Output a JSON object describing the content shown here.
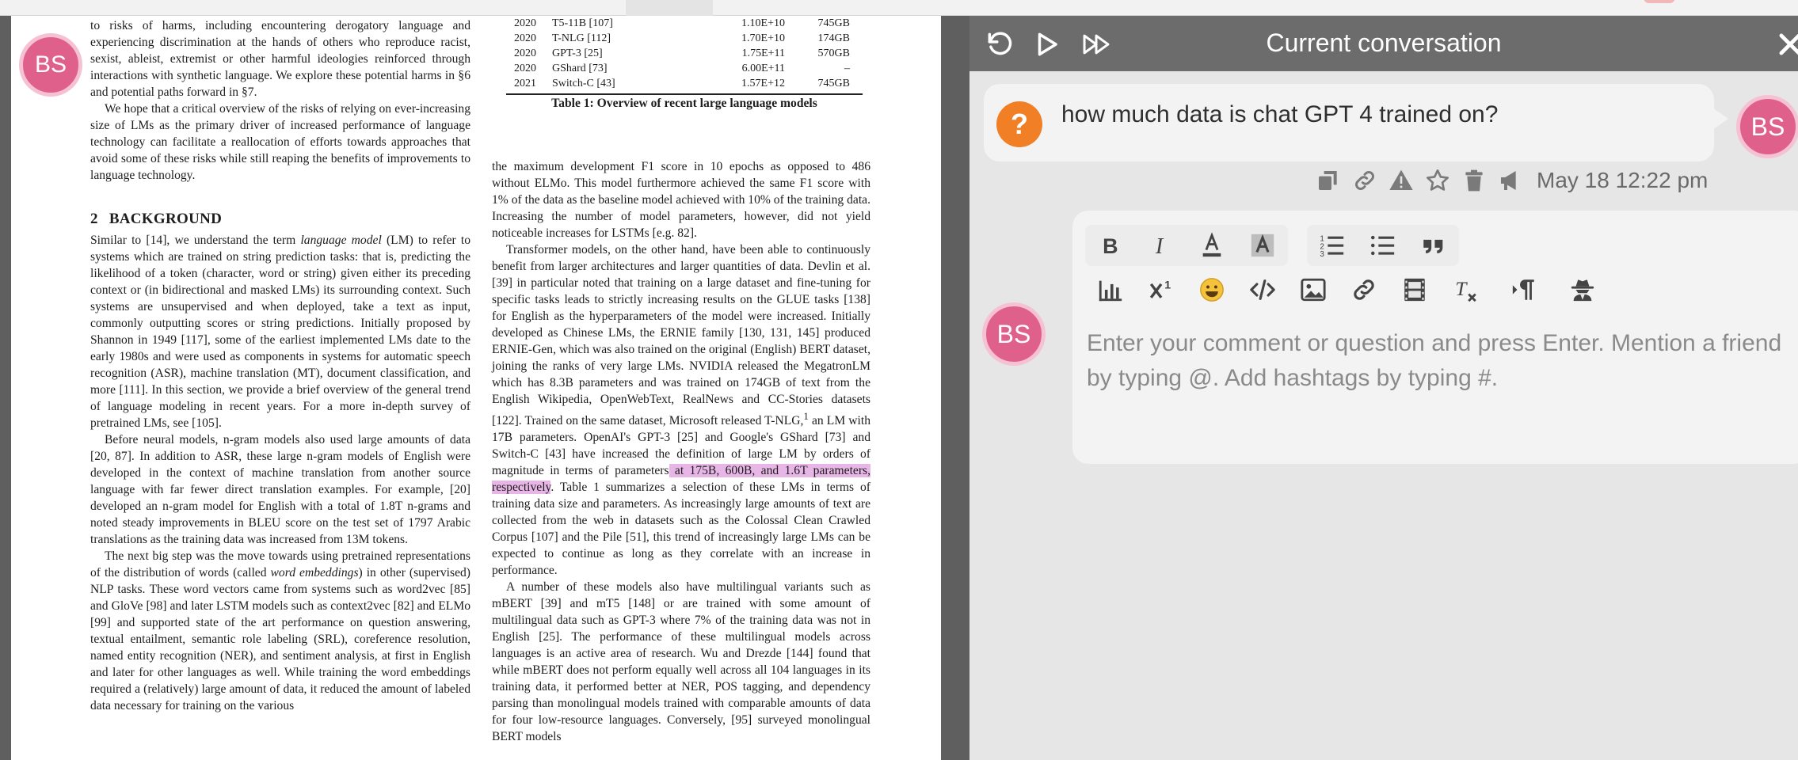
{
  "doc": {
    "avatar_initials": "BS",
    "col1": {
      "p1": "to risks of harms, including encountering derogatory language and experiencing discrimination at the hands of others who reproduce racist, sexist, ableist, extremist or other harmful ideologies reinforced through interactions with synthetic language. We explore these potential harms in §6 and potential paths forward in §7.",
      "p2": "We hope that a critical overview of the risks of relying on ever-increasing size of LMs as the primary driver of increased performance of language technology can facilitate a reallocation of efforts towards approaches that avoid some of these risks while still reaping the benefits of improvements to language technology.",
      "section_number": "2",
      "section_title": "BACKGROUND",
      "p3_a": "Similar to [14], we understand the term ",
      "p3_em": "language model",
      "p3_b": " (LM) to refer to systems which are trained on string prediction tasks: that is, predicting the likelihood of a token (character, word or string) given either its preceding context or (in bidirectional and masked LMs) its surrounding context. Such systems are unsupervised and when deployed, take a text as input, commonly outputting scores or string predictions. Initially proposed by Shannon in 1949 [117], some of the earliest implemented LMs date to the early 1980s and were used as components in systems for automatic speech recognition (ASR), machine translation (MT), document classification, and more [111]. In this section, we provide a brief overview of the general trend of language modeling in recent years. For a more in-depth survey of pretrained LMs, see [105].",
      "p4": "Before neural models, n-gram models also used large amounts of data [20, 87]. In addition to ASR, these large n-gram models of English were developed in the context of machine translation from another source language with far fewer direct translation examples. For example, [20] developed an n-gram model for English with a total of 1.8T n-grams and noted steady improvements in BLEU score on the test set of 1797 Arabic translations as the training data was increased from 13M tokens.",
      "p5_a": "The next big step was the move towards using pretrained representations of the distribution of words (called ",
      "p5_em": "word embeddings",
      "p5_b": ") in other (supervised) NLP tasks. These word vectors came from systems such as word2vec [85] and GloVe [98] and later LSTM models such as context2vec [82] and ELMo [99] and supported state of the art performance on question answering, textual entailment, semantic role labeling (SRL), coreference resolution, named entity recognition (NER), and sentiment analysis, at first in English and later for other languages as well. While training the word embeddings required a (relatively) large amount of data, it reduced the amount of labeled data necessary for training on the various"
    },
    "table": {
      "rows": [
        {
          "year": "2020",
          "model": "T5-11B [107]",
          "params": "1.10E+10",
          "size": "745GB"
        },
        {
          "year": "2020",
          "model": "T-NLG [112]",
          "params": "1.70E+10",
          "size": "174GB"
        },
        {
          "year": "2020",
          "model": "GPT-3 [25]",
          "params": "1.75E+11",
          "size": "570GB"
        },
        {
          "year": "2020",
          "model": "GShard [73]",
          "params": "6.00E+11",
          "size": "–"
        },
        {
          "year": "2021",
          "model": "Switch-C [43]",
          "params": "1.57E+12",
          "size": "745GB"
        }
      ],
      "caption": "Table 1: Overview of recent large language models"
    },
    "col2": {
      "p1": "the maximum development F1 score in 10 epochs as opposed to 486 without ELMo. This model furthermore achieved the same F1 score with 1% of the data as the baseline model achieved with 10% of the training data. Increasing the number of model parameters, however, did not yield noticeable increases for LSTMs [e.g. 82].",
      "p2_a": "Transformer models, on the other hand, have been able to continuously benefit from larger architectures and larger quantities of data. Devlin et al. [39] in particular noted that training on a large dataset and fine-tuning for specific tasks leads to strictly increasing results on the GLUE tasks [138] for English as the hyperparameters of the model were increased. Initially developed as Chinese LMs, the ERNIE family [130, 131, 145] produced ERNIE-Gen, which was also trained on the original (English) BERT dataset, joining the ranks of very large LMs. NVIDIA released the MegatronLM which has 8.3B parameters and was trained on 174GB of text from the English Wikipedia, OpenWebText, RealNews and CC-Stories datasets [122]. Trained on the same dataset, Microsoft released T-NLG,",
      "p2_sup": "1",
      "p2_b": " an LM with 17B parameters. OpenAI's GPT-3 [25] and Google's GShard [73] and Switch-C [43] have increased the definition of large LM by orders of magnitude in terms of parameters",
      "p2_hl": " at 175B, 600B, and 1.6T parameters, respectively",
      "p2_c": ". Table 1 summarizes a selection of these LMs in terms of training data size and parameters. As increasingly large amounts of text are collected from the web in datasets such as the Colossal Clean Crawled Corpus [107] and the Pile [51], this trend of increasingly large LMs can be expected to continue as long as they correlate with an increase in performance.",
      "p3": "A number of these models also have multilingual variants such as mBERT [39] and mT5 [148] or are trained with some amount of multilingual data such as GPT-3 where 7% of the training data was not in English [25]. The performance of these multilingual models across languages is an active area of research. Wu and Drezde [144] found that while mBERT does not perform equally well across all 104 languages in its training data, it performed better at NER, POS tagging, and dependency parsing than monolingual models trained with comparable amounts of data for four low-resource languages. Conversely, [95] surveyed monolingual BERT models"
    }
  },
  "panel": {
    "title": "Current conversation",
    "question": {
      "icon_label": "?",
      "text": "how much data is chat GPT 4 trained on?",
      "avatar_initials": "BS"
    },
    "timestamp": "May 18 12:22 pm",
    "composer": {
      "avatar_initials": "BS",
      "placeholder": "Enter your comment or question and press Enter. Mention a friend by typing @. Add hashtags by typing #."
    }
  },
  "colors": {
    "header_bg": "#6c6c6c",
    "panel_bg": "#e6e6e6",
    "avatar_pink": "#e0608c",
    "question_orange": "#f07f25",
    "highlight": "#e8b6e6"
  }
}
